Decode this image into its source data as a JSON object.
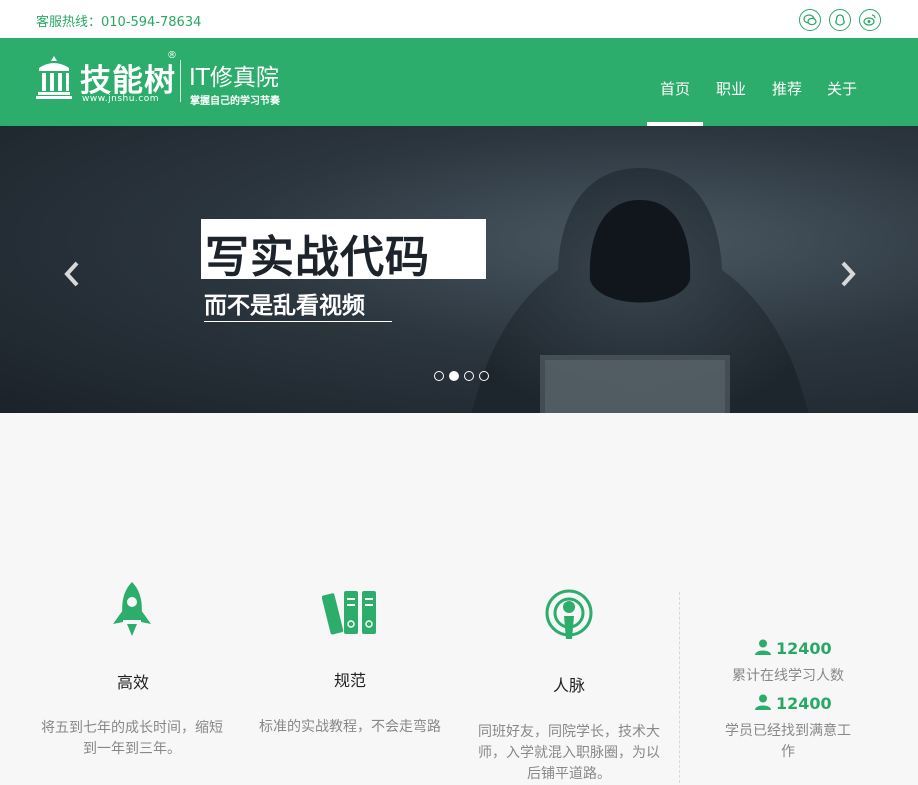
{
  "topbar": {
    "hotline": "客服热线：010-594-78634",
    "social_icons": [
      "wechat-icon",
      "qq-icon",
      "weibo-icon"
    ]
  },
  "header": {
    "logo_name": "技能树",
    "logo_url": "www.jnshu.com",
    "logo_reg": "®",
    "logo_sub": "IT修真院",
    "logo_slogan": "掌握自己的学习节奏",
    "nav": [
      "首页",
      "职业",
      "推荐",
      "关于"
    ],
    "active_nav": "首页"
  },
  "banner": {
    "headline": "写实战代码",
    "subline": "而不是乱看视频",
    "slide_count": 4,
    "active_slide": 2
  },
  "features": [
    {
      "icon": "rocket-icon",
      "title": "高效",
      "desc": [
        "将五到七年的成长时间，缩短",
        "到一年到三年。"
      ]
    },
    {
      "icon": "books-icon",
      "title": "规范",
      "desc": [
        "标准的实战教程，不会走弯路"
      ]
    },
    {
      "icon": "broadcast-icon",
      "title": "人脉",
      "desc": [
        "同班好友，同院学长，技术大",
        "师，入学就混入职脉圈，为以",
        "后铺平道路。"
      ]
    }
  ],
  "stats": [
    {
      "value": "12400",
      "label": [
        "累计在线学习人数"
      ]
    },
    {
      "value": "12400",
      "label": [
        "学员已经找到满意工",
        "作"
      ]
    }
  ],
  "colors": {
    "brand_green": "#2cad6b",
    "text_green": "#29a865",
    "banner_dark": "#1b2229"
  }
}
